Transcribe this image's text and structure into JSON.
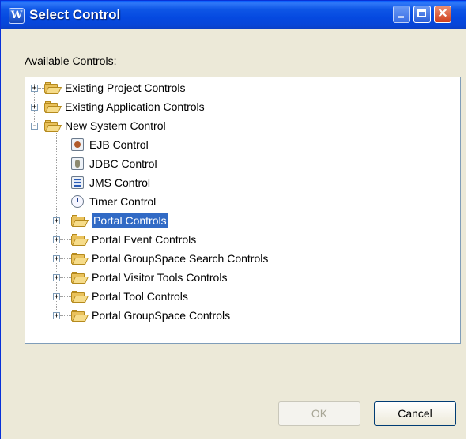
{
  "window": {
    "title": "Select Control",
    "app_icon_letter": "W"
  },
  "dialog": {
    "label": "Available Controls:"
  },
  "tree": {
    "items": [
      {
        "label": "Existing Project Controls",
        "type": "folder",
        "expander": "+",
        "level": 0
      },
      {
        "label": "Existing Application Controls",
        "type": "folder",
        "expander": "+",
        "level": 0
      },
      {
        "label": "New System Control",
        "type": "folder",
        "expander": "-",
        "level": 0
      },
      {
        "label": "EJB Control",
        "type": "control",
        "icon": "ejb-icon",
        "level": 1
      },
      {
        "label": "JDBC Control",
        "type": "control",
        "icon": "jdbc-icon",
        "level": 1
      },
      {
        "label": "JMS Control",
        "type": "control",
        "icon": "jms-icon",
        "level": 1
      },
      {
        "label": "Timer Control",
        "type": "control",
        "icon": "timer-icon",
        "level": 1
      },
      {
        "label": "Portal Controls",
        "type": "folder",
        "expander": "+",
        "level": 1,
        "selected": true
      },
      {
        "label": "Portal Event Controls",
        "type": "folder",
        "expander": "+",
        "level": 1
      },
      {
        "label": "Portal GroupSpace Search Controls",
        "type": "folder",
        "expander": "+",
        "level": 1
      },
      {
        "label": "Portal Visitor Tools Controls",
        "type": "folder",
        "expander": "+",
        "level": 1
      },
      {
        "label": "Portal Tool Controls",
        "type": "folder",
        "expander": "+",
        "level": 1
      },
      {
        "label": "Portal GroupSpace Controls",
        "type": "folder",
        "expander": "+",
        "level": 1
      }
    ]
  },
  "buttons": {
    "ok_label": "OK",
    "ok_enabled": false,
    "cancel_label": "Cancel"
  },
  "colors": {
    "titlebar": "#0a55e6",
    "selection": "#316ac5",
    "dialog_bg": "#ece9d8"
  }
}
